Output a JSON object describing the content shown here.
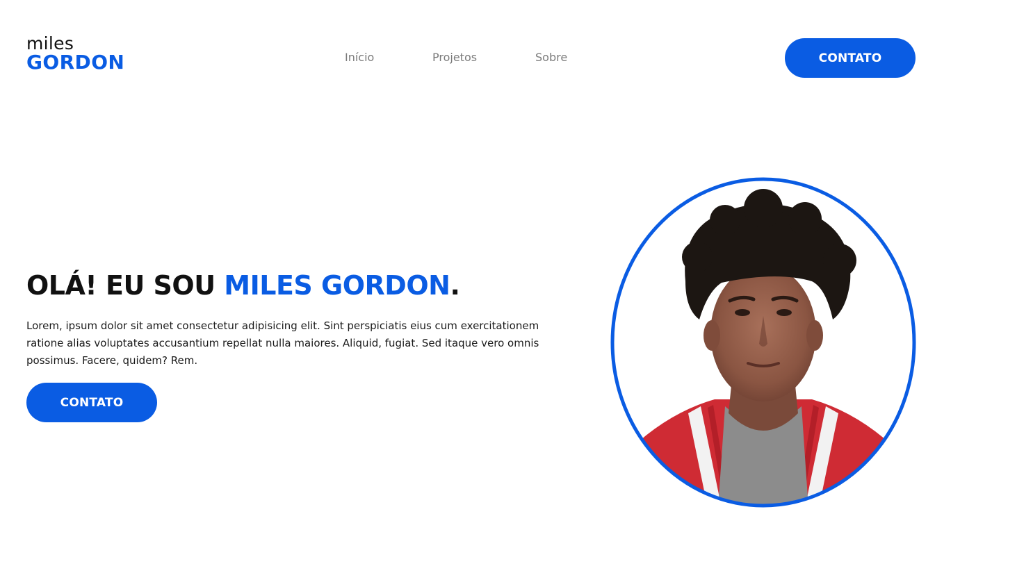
{
  "header": {
    "logo_top": "miles",
    "logo_bottom": "GORDON",
    "nav": [
      "Início",
      "Projetos",
      "Sobre"
    ],
    "cta_label": "CONTATO"
  },
  "hero": {
    "title_prefix": "OLÁ! EU SOU ",
    "title_name": "MILES GORDON",
    "title_suffix": ".",
    "description": "Lorem, ipsum dolor sit amet consectetur adipisicing elit. Sint perspiciatis eius cum exercitationem ratione alias voluptates accusantium repellat nulla maiores. Aliquid, fugiat. Sed itaque vero omnis possimus. Facere, quidem? Rem.",
    "cta_label": "CONTATO",
    "portrait_icon": "portrait-photo"
  },
  "colors": {
    "accent": "#0a5ce3",
    "text_dark": "#111111",
    "nav_text": "#7a7a7a",
    "background": "#ffffff"
  }
}
